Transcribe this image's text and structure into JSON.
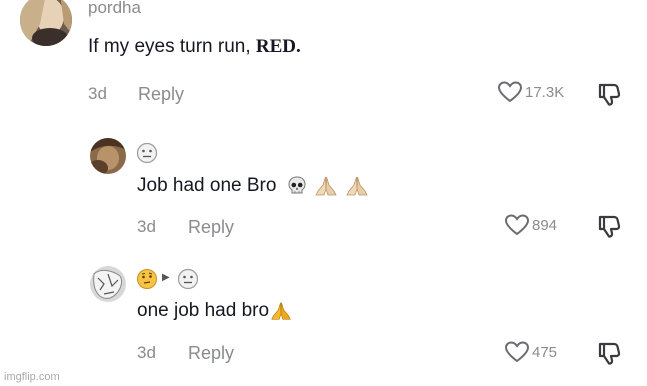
{
  "comments": [
    {
      "username": "pordha",
      "text_main": "If my eyes turn run, ",
      "text_red": "RED.",
      "age": "3d",
      "reply_label": "Reply",
      "likes": "17.3K"
    },
    {
      "text": "Job had one Bro",
      "age": "3d",
      "reply_label": "Reply",
      "likes": "894",
      "emoji_icons": [
        "skull-emoji-icon",
        "praying-hands-emoji-icon",
        "praying-hands-emoji-icon"
      ]
    },
    {
      "text": "one job had bro",
      "age": "3d",
      "reply_label": "Reply",
      "likes": "475",
      "emoji_icons": [
        "praying-hands-emoji-icon"
      ]
    }
  ],
  "watermark": "imgflip.com",
  "colors": {
    "text": "#161823",
    "muted": "#8a8b91",
    "background": "#ffffff"
  }
}
